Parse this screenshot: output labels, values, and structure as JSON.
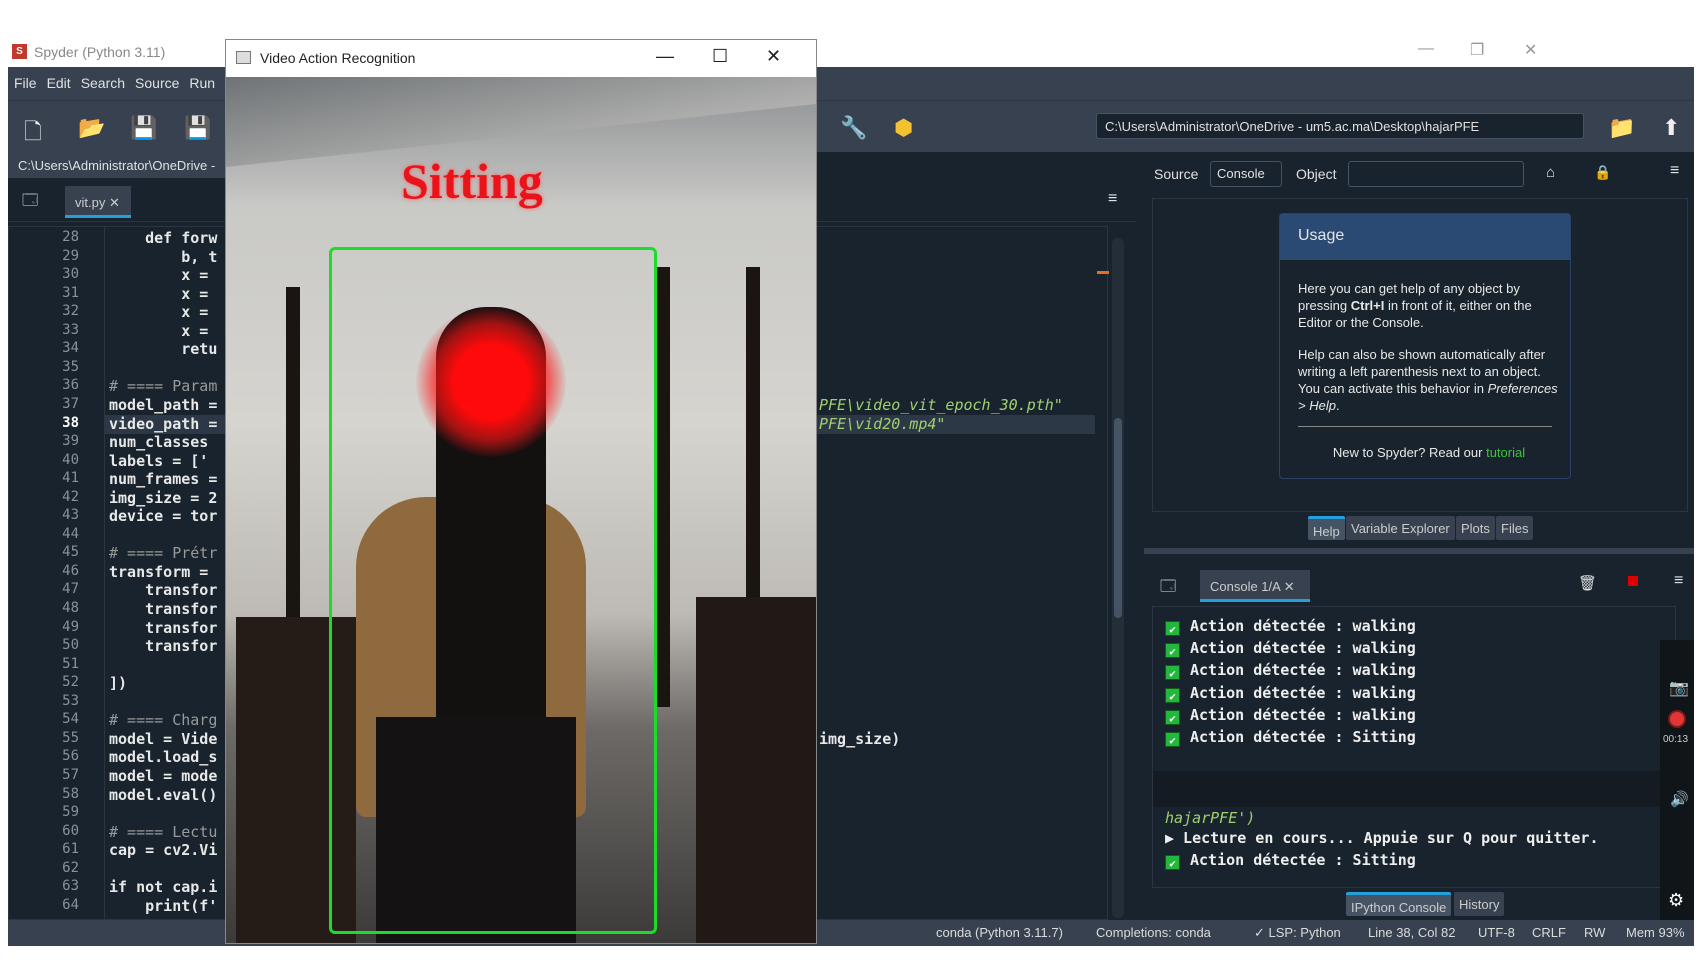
{
  "spyder": {
    "title": "Spyder (Python 3.11)",
    "menu": [
      "File",
      "Edit",
      "Search",
      "Source",
      "Run"
    ],
    "working_dir": "C:\\Users\\Administrator\\OneDrive - um5.ac.ma\\Desktop\\hajarPFE",
    "editor_path": "C:\\Users\\Administrator\\OneDrive -",
    "editor_tab": "vit.py",
    "current_line": 38,
    "code_lines": [
      {
        "n": 28,
        "t": "    def forw",
        "c": false
      },
      {
        "n": 29,
        "t": "        b, t",
        "c": false
      },
      {
        "n": 30,
        "t": "        x =",
        "c": false
      },
      {
        "n": 31,
        "t": "        x =",
        "c": false
      },
      {
        "n": 32,
        "t": "        x =",
        "c": false
      },
      {
        "n": 33,
        "t": "        x =",
        "c": false
      },
      {
        "n": 34,
        "t": "        retu",
        "c": false
      },
      {
        "n": 35,
        "t": "",
        "c": false
      },
      {
        "n": 36,
        "t": "# ==== Param",
        "c": true
      },
      {
        "n": 37,
        "t": "model_path =",
        "c": false
      },
      {
        "n": 38,
        "t": "video_path =",
        "c": false
      },
      {
        "n": 39,
        "t": "num_classes",
        "c": false
      },
      {
        "n": 40,
        "t": "labels = ['",
        "c": false
      },
      {
        "n": 41,
        "t": "num_frames =",
        "c": false
      },
      {
        "n": 42,
        "t": "img_size = 2",
        "c": false
      },
      {
        "n": 43,
        "t": "device = tor",
        "c": false
      },
      {
        "n": 44,
        "t": "",
        "c": false
      },
      {
        "n": 45,
        "t": "# ==== Prétr",
        "c": true
      },
      {
        "n": 46,
        "t": "transform =",
        "c": false
      },
      {
        "n": 47,
        "t": "    transfor",
        "c": false
      },
      {
        "n": 48,
        "t": "    transfor",
        "c": false
      },
      {
        "n": 49,
        "t": "    transfor",
        "c": false
      },
      {
        "n": 50,
        "t": "    transfor",
        "c": false
      },
      {
        "n": 51,
        "t": "",
        "c": false
      },
      {
        "n": 52,
        "t": "])",
        "c": false
      },
      {
        "n": 53,
        "t": "",
        "c": false
      },
      {
        "n": 54,
        "t": "# ==== Charg",
        "c": true
      },
      {
        "n": 55,
        "t": "model = Vide",
        "c": false
      },
      {
        "n": 56,
        "t": "model.load_s",
        "c": false
      },
      {
        "n": 57,
        "t": "model = mode",
        "c": false
      },
      {
        "n": 58,
        "t": "model.eval()",
        "c": false
      },
      {
        "n": 59,
        "t": "",
        "c": false
      },
      {
        "n": 60,
        "t": "# ==== Lectu",
        "c": true
      },
      {
        "n": 61,
        "t": "cap = cv2.Vi",
        "c": false
      },
      {
        "n": 62,
        "t": "",
        "c": false
      },
      {
        "n": 63,
        "t": "if not cap.i",
        "c": false
      },
      {
        "n": 64,
        "t": "    print(f'",
        "c": false
      }
    ],
    "code_tails": {
      "l37": "PFE\\video_vit_epoch_30.pth\"",
      "l38": "PFE\\vid20.mp4\"",
      "l55": "img_size)"
    },
    "help": {
      "source_label": "Source",
      "source_value": "Console",
      "object_label": "Object",
      "usage_title": "Usage",
      "p1a": "Here you can get help of any object by pressing ",
      "p1b": "Ctrl+I",
      "p1c": " in front of it, either on the Editor or the Console.",
      "p2a": "Help can also be shown automatically after writing a left parenthesis next to an object. You can activate this behavior in ",
      "p2b": "Preferences > Help",
      "p2c": ".",
      "p3": "New to Spyder? Read our ",
      "p3link": "tutorial"
    },
    "pane_tabs": [
      "Help",
      "Variable Explorer",
      "Plots",
      "Files"
    ],
    "console": {
      "tab": "Console 1/A",
      "lines": [
        "Action détectée : walking",
        "Action détectée : walking",
        "Action détectée : walking",
        "Action détectée : walking",
        "Action détectée : walking",
        "Action détectée : Sitting"
      ],
      "path_tail": "hajarPFE')",
      "reading": "▶ Lecture en cours... Appuie sur Q pour quitter.",
      "last": "Action détectée : Sitting"
    },
    "console_tabs": [
      "IPython Console",
      "History"
    ],
    "status": [
      "conda (Python 3.11.7)",
      "Completions: conda",
      "✓ LSP: Python",
      "Line 38, Col 82",
      "UTF-8",
      "CRLF",
      "RW",
      "Mem 93%"
    ],
    "recorder_time": "00:13"
  },
  "video": {
    "title": "Video Action Recognition",
    "label": "Sitting",
    "box_color": "#1cdc2a",
    "label_color": "#e8141a"
  },
  "colors": {
    "bg": "#19232d",
    "panel": "#37414f",
    "accent": "#26a0da"
  }
}
